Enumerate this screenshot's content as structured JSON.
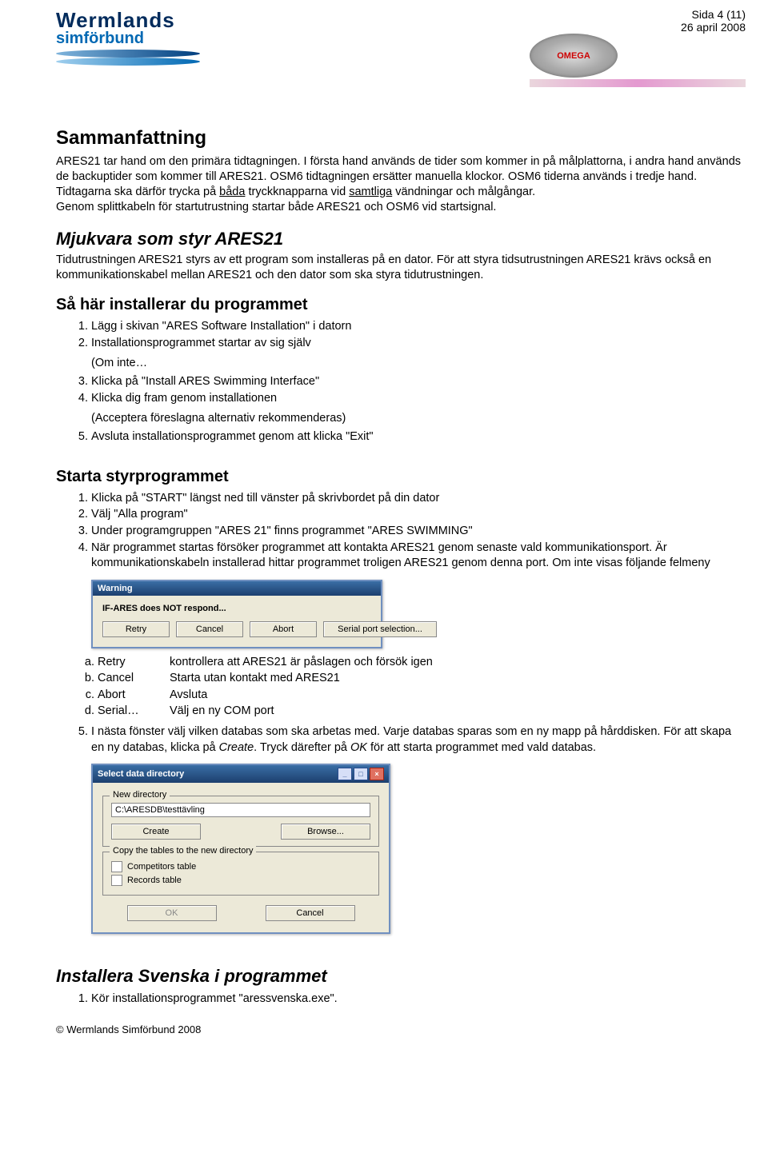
{
  "header": {
    "logo_line1": "Wermlands",
    "logo_line2": "simförbund",
    "page_info": "Sida 4 (11)",
    "date": "26 april 2008",
    "omega_text": "OMEGA"
  },
  "s1": {
    "title": "Sammanfattning",
    "p1a": "ARES21 tar hand om den primära tidtagningen. I första hand används de tider som kommer in på målplattorna, i andra hand används de backuptider som kommer till ARES21. OSM6 tidtagningen ersätter manuella klockor. OSM6 tiderna används i tredje hand. Tidtagarna ska därför trycka på ",
    "p1_u1": "båda",
    "p1b": " tryckknapparna vid ",
    "p1_u2": "samtliga",
    "p1c": " vändningar och målgångar.",
    "p2": "Genom splittkabeln för startutrustning startar både ARES21 och OSM6 vid startsignal."
  },
  "s2": {
    "title": "Mjukvara som styr ARES21",
    "p": "Tidutrustningen ARES21 styrs av ett program som installeras på en dator. För att styra tidsutrustningen ARES21 krävs också en kommunikationskabel mellan ARES21 och den dator som ska styra tidutrustningen."
  },
  "s3": {
    "title": "Så här installerar du programmet",
    "items": [
      "Lägg i skivan \"ARES Software Installation\" i datorn",
      "Installationsprogrammet startar av sig själv",
      "Klicka på \"Install ARES Swimming Interface\"",
      "Klicka dig fram genom installationen",
      "Avsluta installationsprogrammet genom att klicka \"Exit\""
    ],
    "note2": "(Om inte…",
    "note4": "(Acceptera föreslagna alternativ rekommenderas)"
  },
  "s4": {
    "title": "Starta styrprogrammet",
    "items": [
      "Klicka på \"START\" längst ned till vänster på skrivbordet på din dator",
      "Välj \"Alla program\"",
      "Under programgruppen \"ARES 21\" finns programmet \"ARES SWIMMING\"",
      "När programmet startas försöker programmet att kontakta ARES21 genom senaste vald kommunikationsport. Är kommunikationskabeln installerad hittar programmet troligen ARES21 genom denna port. Om inte visas följande felmeny"
    ],
    "warn_title": "Warning",
    "warn_text": "IF-ARES does NOT respond...",
    "warn_buttons": [
      "Retry",
      "Cancel",
      "Abort",
      "Serial port selection..."
    ],
    "alpha": [
      {
        "k": "Retry",
        "v": "kontrollera att ARES21 är påslagen och försök igen"
      },
      {
        "k": "Cancel",
        "v": "Starta utan kontakt med ARES21"
      },
      {
        "k": "Abort",
        "v": "Avsluta"
      },
      {
        "k": "Serial…",
        "v": "Välj en ny COM port"
      }
    ],
    "item5a": "I nästa fönster välj vilken databas som ska arbetas med. Varje databas sparas som en ny mapp på hårddisken. För att skapa en ny databas, klicka på ",
    "item5_i1": "Create",
    "item5b": ". Tryck därefter på ",
    "item5_i2": "OK",
    "item5c": " för att starta programmet med vald databas.",
    "sel_title": "Select data directory",
    "grp1_title": "New directory",
    "path": "C:\\ARESDB\\testtävling",
    "create_btn": "Create",
    "browse_btn": "Browse...",
    "grp2_title": "Copy the tables to the new directory",
    "chk1": "Competitors table",
    "chk2": "Records table",
    "ok": "OK",
    "cancel": "Cancel"
  },
  "s5": {
    "title": "Installera Svenska i programmet",
    "item1": "Kör installationsprogrammet \"aressvenska.exe\"."
  },
  "footer": "© Wermlands Simförbund 2008"
}
